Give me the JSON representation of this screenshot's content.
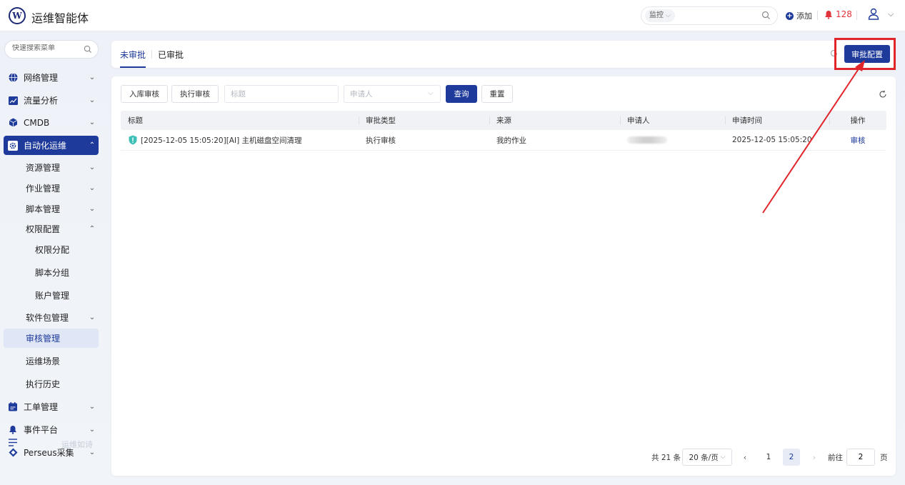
{
  "header": {
    "app_title": "运维智能体",
    "logo_letter": "W",
    "search_type": "监控",
    "search_placeholder": "",
    "add_label": "添加",
    "alert_count": "128"
  },
  "sidebar": {
    "search_placeholder": "快速搜索菜单",
    "items": [
      {
        "label": "网络管理"
      },
      {
        "label": "流量分析"
      },
      {
        "label": "CMDB"
      },
      {
        "label": "自动化运维"
      },
      {
        "label": "资源管理"
      },
      {
        "label": "作业管理"
      },
      {
        "label": "脚本管理"
      },
      {
        "label": "权限配置"
      },
      {
        "label": "权限分配"
      },
      {
        "label": "脚本分组"
      },
      {
        "label": "账户管理"
      },
      {
        "label": "软件包管理"
      },
      {
        "label": "审核管理"
      },
      {
        "label": "运维场景"
      },
      {
        "label": "执行历史"
      },
      {
        "label": "工单管理"
      },
      {
        "label": "事件平台"
      },
      {
        "label": "Perseus采集"
      }
    ],
    "footer_text": "运维如诗"
  },
  "tabs": {
    "unapproved": "未审批",
    "approved": "已审批",
    "config_button": "审批配置"
  },
  "filters": {
    "btn_warehouse": "入库审核",
    "btn_exec": "执行审核",
    "title_placeholder": "标题",
    "applicant_placeholder": "申请人",
    "query": "查询",
    "reset": "重置"
  },
  "table": {
    "headers": [
      "标题",
      "审批类型",
      "来源",
      "申请人",
      "申请时间",
      "操作"
    ],
    "rows": [
      {
        "title": "[2025-12-05 15:05:20][AI] 主机磁盘空间清理",
        "type": "执行审核",
        "source": "我的作业",
        "applicant": "",
        "time": "2025-12-05 15:05:20",
        "action": "审核"
      }
    ]
  },
  "pagination": {
    "total": "共 21 条",
    "page_size": "20 条/页",
    "pages": [
      "1",
      "2"
    ],
    "current_page": 2,
    "goto_label": "前往",
    "goto_value": "2",
    "page_suffix": "页"
  },
  "colors": {
    "primary": "#1e3a9a",
    "alert": "#e2323a",
    "annotation": "#e0262b"
  }
}
